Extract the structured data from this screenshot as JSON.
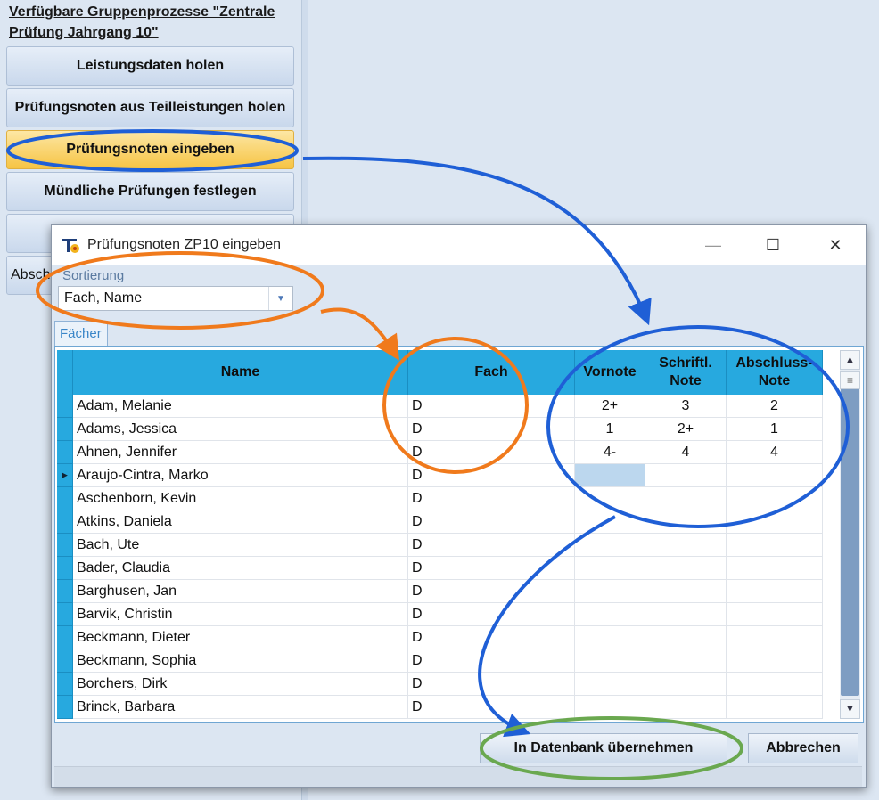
{
  "left_panel": {
    "title": "Verfügbare Gruppenprozesse \"Zentrale Prüfung Jahrgang 10\"",
    "buttons": [
      {
        "label": "Leistungsdaten holen",
        "active": false
      },
      {
        "label": "Prüfungsnoten aus Teilleistungen holen",
        "active": false
      },
      {
        "label": "Prüfungsnoten eingeben",
        "active": true
      },
      {
        "label": "Mündliche Prüfungen festlegen",
        "active": false
      },
      {
        "label": "",
        "active": false
      },
      {
        "label": "Absch",
        "active": false
      }
    ]
  },
  "dialog": {
    "title": "Prüfungsnoten ZP10 eingeben",
    "controls": {
      "minimize": "—",
      "maximize": "☐",
      "close": "✕"
    },
    "sort": {
      "label": "Sortierung",
      "value": "Fach, Name"
    },
    "tab": "Fächer",
    "columns": [
      "Name",
      "Fach",
      "Vornote",
      "Schriftl. Note",
      "Abschluss-Note"
    ],
    "rows": [
      {
        "name": "Adam, Melanie",
        "fach": "D",
        "vornote": "2+",
        "schriftl": "3",
        "abschluss": "2"
      },
      {
        "name": "Adams, Jessica",
        "fach": "D",
        "vornote": "1",
        "schriftl": "2+",
        "abschluss": "1"
      },
      {
        "name": "Ahnen, Jennifer",
        "fach": "D",
        "vornote": "4-",
        "schriftl": "4",
        "abschluss": "4"
      },
      {
        "name": "Araujo-Cintra, Marko",
        "fach": "D",
        "vornote": "",
        "schriftl": "",
        "abschluss": "",
        "current": true
      },
      {
        "name": "Aschenborn, Kevin",
        "fach": "D",
        "vornote": "",
        "schriftl": "",
        "abschluss": ""
      },
      {
        "name": "Atkins, Daniela",
        "fach": "D",
        "vornote": "",
        "schriftl": "",
        "abschluss": ""
      },
      {
        "name": "Bach, Ute",
        "fach": "D",
        "vornote": "",
        "schriftl": "",
        "abschluss": ""
      },
      {
        "name": "Bader, Claudia",
        "fach": "D",
        "vornote": "",
        "schriftl": "",
        "abschluss": ""
      },
      {
        "name": "Barghusen, Jan",
        "fach": "D",
        "vornote": "",
        "schriftl": "",
        "abschluss": ""
      },
      {
        "name": "Barvik, Christin",
        "fach": "D",
        "vornote": "",
        "schriftl": "",
        "abschluss": ""
      },
      {
        "name": "Beckmann, Dieter",
        "fach": "D",
        "vornote": "",
        "schriftl": "",
        "abschluss": ""
      },
      {
        "name": "Beckmann, Sophia",
        "fach": "D",
        "vornote": "",
        "schriftl": "",
        "abschluss": ""
      },
      {
        "name": "Borchers, Dirk",
        "fach": "D",
        "vornote": "",
        "schriftl": "",
        "abschluss": ""
      },
      {
        "name": "Brinck, Barbara",
        "fach": "D",
        "vornote": "",
        "schriftl": "",
        "abschluss": ""
      }
    ],
    "buttons": {
      "apply": "In Datenbank übernehmen",
      "cancel": "Abbrechen"
    }
  },
  "colors": {
    "grid_header": "#27a9df",
    "active_button": "#f6c444",
    "annotation_blue": "#1f5fd6",
    "annotation_orange": "#f07a1c",
    "annotation_green": "#6aa84f"
  }
}
